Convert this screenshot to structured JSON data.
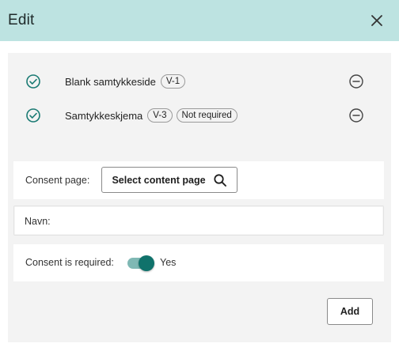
{
  "dialog": {
    "title": "Edit",
    "close_icon": "close-icon"
  },
  "documents": [
    {
      "name": "Blank samtykkeside",
      "chips": [
        "V-1"
      ],
      "status_icon": "check-circle-icon",
      "action_icon": "remove-circle-icon"
    },
    {
      "name": "Samtykkeskjema",
      "chips": [
        "V-3",
        "Not required"
      ],
      "status_icon": "check-circle-icon",
      "action_icon": "remove-circle-icon"
    }
  ],
  "consent_page": {
    "label": "Consent page:",
    "button_label": "Select content page",
    "button_icon": "search-icon"
  },
  "navn": {
    "label": "Navn:",
    "value": "",
    "placeholder": ""
  },
  "consent_required": {
    "label": "Consent is required:",
    "toggle_on": true,
    "state_label": "Yes"
  },
  "actions": {
    "add_label": "Add"
  },
  "colors": {
    "header_bg": "#bde3e1",
    "accent": "#10726b",
    "accent_light": "#7fb8b4",
    "panel_bg": "#f3f3f3"
  }
}
